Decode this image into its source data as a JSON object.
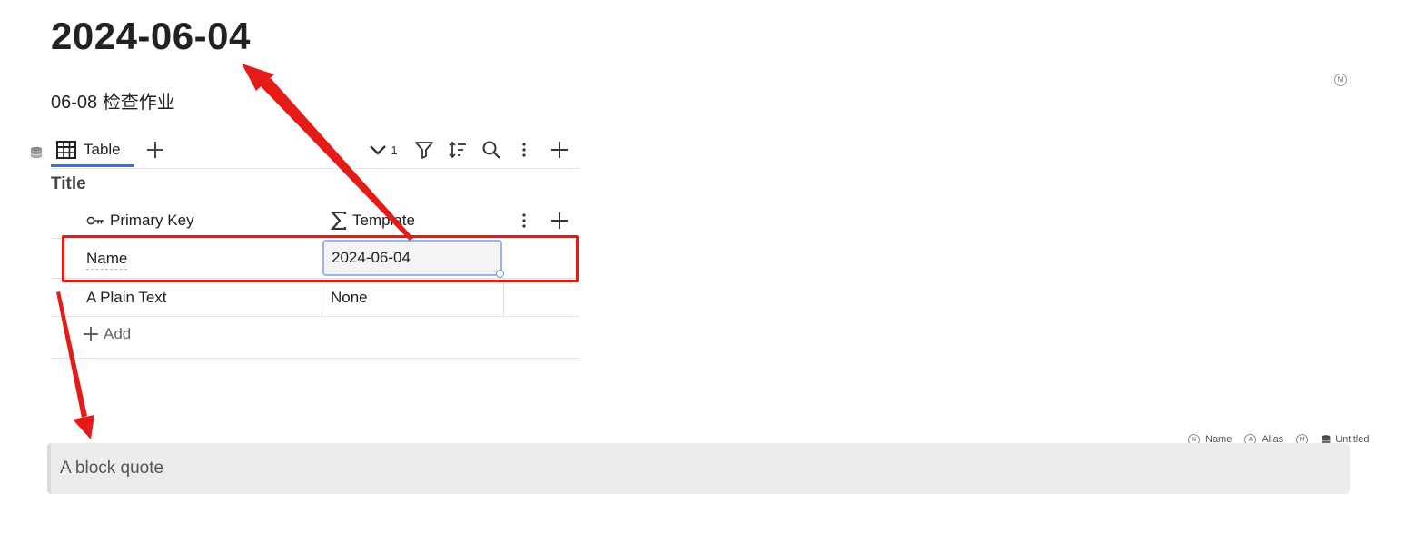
{
  "document": {
    "title": "2024-06-04",
    "subtitle": "06-08 检查作业",
    "corner_badge": "M"
  },
  "database": {
    "view_tab_label": "Table",
    "toolbar": {
      "collapse_count": "1"
    },
    "group_title": "Title",
    "columns": [
      {
        "label": "Primary Key",
        "icon": "key-icon"
      },
      {
        "label": "Template",
        "icon": "sigma-icon"
      }
    ],
    "rows": [
      {
        "key": "Name",
        "value": "2024-06-04"
      },
      {
        "key": "A Plain Text",
        "value": "None"
      }
    ],
    "add_label": "Add"
  },
  "footer_meta": {
    "name_badge": "N",
    "name_label": "Name",
    "alias_badge": "A",
    "alias_label": "Alias",
    "m_badge": "M",
    "db_label": "Untitled"
  },
  "blockquote": {
    "text": "A block quote"
  },
  "annotation_colors": {
    "highlight": "#e41b17",
    "accent": "#3b6fd8"
  }
}
